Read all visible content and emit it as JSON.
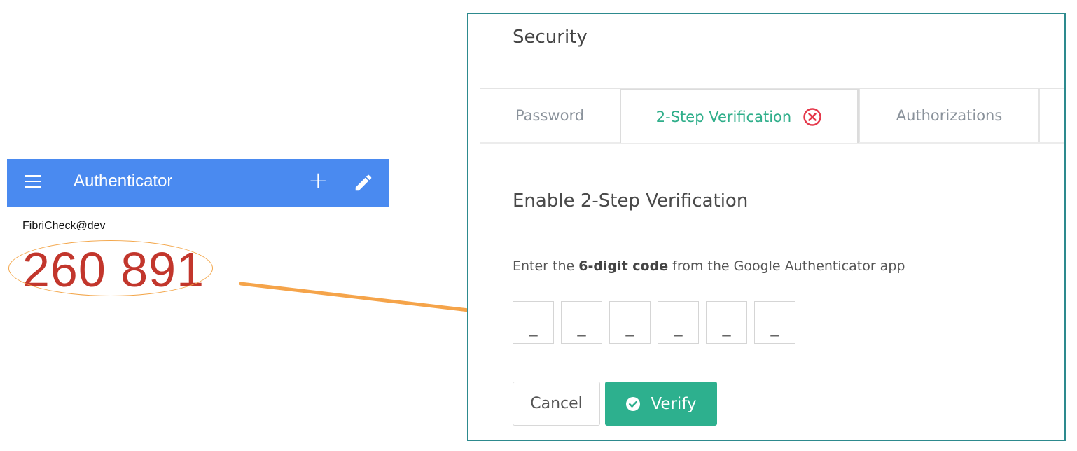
{
  "authenticator": {
    "title": "Authenticator",
    "menu_icon": "hamburger-icon",
    "add_icon": "plus-icon",
    "edit_icon": "pencil-icon",
    "account": "FibriCheck@dev",
    "code": "260 891",
    "colors": {
      "bar": "#4a8af0",
      "code": "#c2362c",
      "highlight": "#f3a64a"
    }
  },
  "security": {
    "title": "Security",
    "tabs": [
      {
        "label": "Password"
      },
      {
        "label": "2-Step Verification",
        "status_icon": "error-circle-icon"
      },
      {
        "label": "Authorizations"
      }
    ],
    "heading": "Enable 2-Step Verification",
    "instruction": {
      "prefix": "Enter the ",
      "emphasis": "6-digit code",
      "suffix": " from the Google Authenticator app"
    },
    "digits": [
      {
        "value": "",
        "placeholder": "_"
      },
      {
        "value": "",
        "placeholder": "_"
      },
      {
        "value": "",
        "placeholder": "_"
      },
      {
        "value": "",
        "placeholder": "_"
      },
      {
        "value": "",
        "placeholder": "_"
      },
      {
        "value": "",
        "placeholder": "_"
      }
    ],
    "cancel_label": "Cancel",
    "verify_label": "Verify",
    "colors": {
      "accent": "#2db08e",
      "error": "#e5384b",
      "frame": "#2d8a8e"
    }
  }
}
